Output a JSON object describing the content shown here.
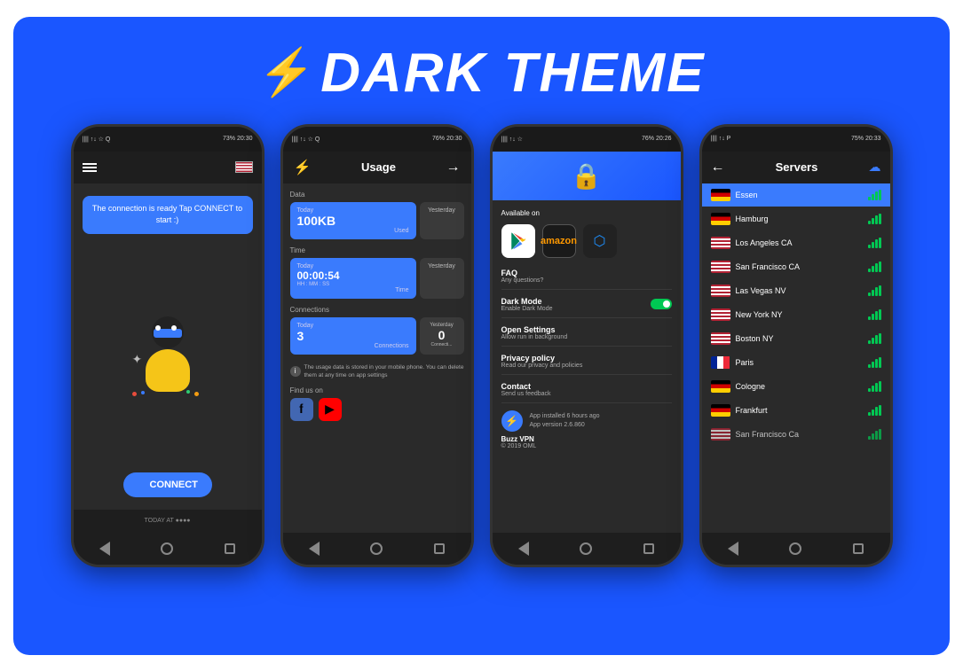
{
  "title": "DARK THEME",
  "bolt_icon": "⚡",
  "phones": {
    "phone1": {
      "status_left": "||||  ↑↓ ☆ Q",
      "status_right": "73%  20:30",
      "message": "The connection is ready\nTap CONNECT to start :)",
      "connect_label": "CONNECT",
      "bottom_label": "TODAY AT ●●●●"
    },
    "phone2": {
      "status_left": "||||  ↑↓ ☆ Q",
      "status_right": "76%  20:30",
      "screen_title": "Usage",
      "data_label": "Data",
      "today_label": "Today",
      "yesterday_label": "Yesterday",
      "data_value": "100KB",
      "data_sub": "Used",
      "time_label": "Time",
      "time_value": "00:00:54",
      "time_sub": "HH : MM : SS",
      "time_sublabel": "Time",
      "connections_label": "Connections",
      "conn_today": "3",
      "conn_today_sub": "Connections",
      "conn_yesterday": "0",
      "conn_yesterday_sub": "Connecti...",
      "info_text": "The usage data is stored in your mobile phone.\nYou can delete them at any time on app\nsettings",
      "find_us_label": "Find us on"
    },
    "phone3": {
      "status_left": "||||  ↑↓ ☆",
      "status_right": "76%  20:26",
      "available_on": "Available on",
      "faq_title": "FAQ",
      "faq_sub": "Any questions?",
      "darkmode_title": "Dark Mode",
      "darkmode_sub": "Enable Dark Mode",
      "opensettings_title": "Open Settings",
      "opensettings_sub": "Allow run in background",
      "privacy_title": "Privacy policy",
      "privacy_sub": "Read our privacy and policies",
      "contact_title": "Contact",
      "contact_sub": "Send us feedback",
      "app_installed": "App installed 6 hours ago",
      "app_version": "App version 2.6.860",
      "app_name": "Buzz VPN",
      "copyright": "© 2019 OML"
    },
    "phone4": {
      "status_left": "||||  ↑↓ P",
      "status_right": "75%  20:33",
      "screen_title": "Servers",
      "servers": [
        {
          "name": "Essen",
          "flag": "de",
          "active": true
        },
        {
          "name": "Hamburg",
          "flag": "de",
          "active": false
        },
        {
          "name": "Los Angeles CA",
          "flag": "us",
          "active": false
        },
        {
          "name": "San Francisco CA",
          "flag": "us",
          "active": false
        },
        {
          "name": "Las Vegas NV",
          "flag": "us",
          "active": false
        },
        {
          "name": "New York NY",
          "flag": "us",
          "active": false
        },
        {
          "name": "Boston NY",
          "flag": "us",
          "active": false
        },
        {
          "name": "Paris",
          "flag": "fr",
          "active": false
        },
        {
          "name": "Cologne",
          "flag": "de",
          "active": false
        },
        {
          "name": "Frankfurt",
          "flag": "de",
          "active": false
        },
        {
          "name": "San Francisco Ca",
          "flag": "us",
          "active": false
        }
      ]
    }
  }
}
